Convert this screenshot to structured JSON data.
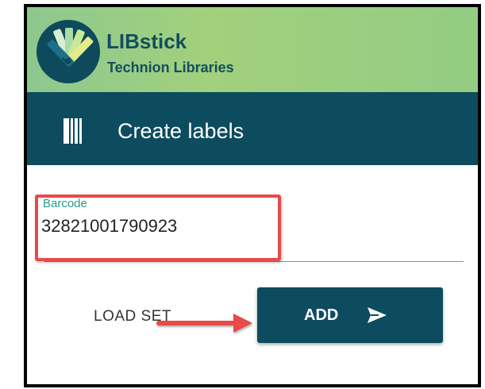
{
  "app": {
    "name": "LIBstick",
    "subtitle": "Technion Libraries",
    "logo_icon": "pencil-stack-logo"
  },
  "header": {
    "title": "Create labels",
    "icon": "barcode-icon"
  },
  "form": {
    "barcode": {
      "label": "Barcode",
      "value": "32821001790923"
    }
  },
  "actions": {
    "load_set_label": "LOAD SET",
    "add_label": "ADD",
    "add_icon": "send-icon"
  },
  "colors": {
    "brand_green": "#9ccf7f",
    "primary_dark": "#0d4c5f",
    "label_teal": "#2a9a88",
    "annotation_red": "#e84a4a"
  }
}
